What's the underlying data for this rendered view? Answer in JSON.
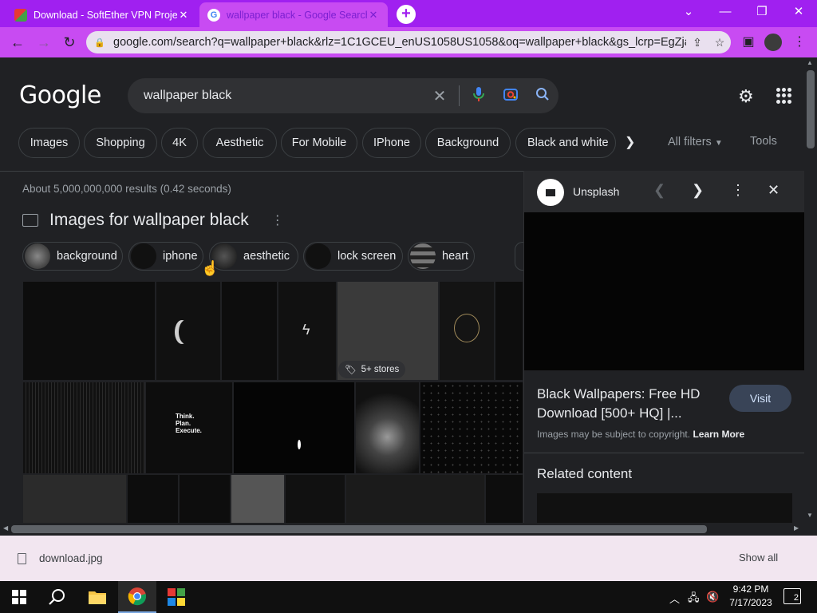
{
  "browser": {
    "tabs": [
      {
        "title": "Download - SoftEther VPN Proje",
        "close": "✕"
      },
      {
        "title": "wallpaper black - Google Search",
        "close": "✕"
      }
    ],
    "new_tab": "+",
    "window_buttons": {
      "dropdown": "⌄",
      "minimize": "—",
      "restore": "❐",
      "close": "✕"
    },
    "nav": {
      "back": "←",
      "forward": "→",
      "reload": "↻"
    },
    "url": "google.com/search?q=wallpaper+black&rlz=1C1GCEU_enUS1058US1058&oq=wallpaper+black&gs_lcrp=EgZja..."
  },
  "google": {
    "logo": "Google",
    "query": "wallpaper black",
    "filter_chips": [
      "Images",
      "Shopping",
      "4K",
      "Aesthetic",
      "For Mobile",
      "IPhone",
      "Background",
      "Black and white"
    ],
    "all_filters": "All filters",
    "tools": "Tools",
    "results_stats": "About 5,000,000,000 results (0.42 seconds)",
    "images_heading": "Images for wallpaper black",
    "related_chips": [
      "background",
      "iphone",
      "aesthetic",
      "lock screen",
      "heart"
    ],
    "stores_badge": "5+ stores",
    "tile_texts": {
      "think": "Think.\nPlan.\nExecute."
    }
  },
  "panel": {
    "source": "Unsplash",
    "title": "Black Wallpapers: Free HD Download [500+ HQ] |...",
    "visit": "Visit",
    "copyright": "Images may be subject to copyright.",
    "learn_more": "Learn More",
    "related": "Related content"
  },
  "downloads": {
    "file": "download.jpg",
    "show_all": "Show all"
  },
  "taskbar": {
    "time": "9:42 PM",
    "date": "7/17/2023",
    "notifications": "2"
  },
  "colors": {
    "browser_frame": "#a020f0",
    "toolbar": "#c84bf2",
    "page_bg": "#202124"
  }
}
